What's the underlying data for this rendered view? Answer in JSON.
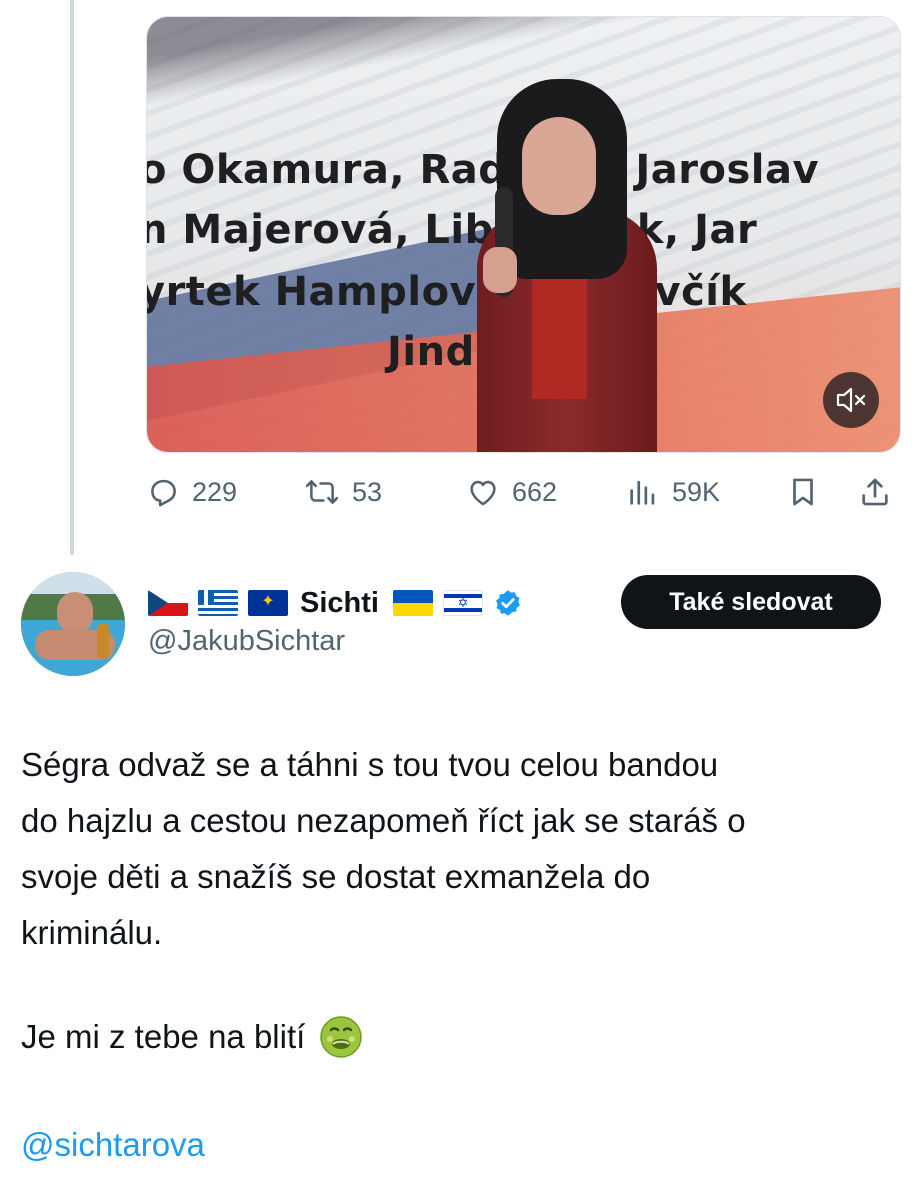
{
  "video": {
    "banner_lines": [
      "o Okamura, Rad   iala, Jaroslav",
      "n Majerová, Lib   dráček, Jar",
      "yrtek Hamplov   slav Ševčík",
      "Jind   ichl"
    ],
    "mute_icon": "speaker-muted-icon"
  },
  "actions": {
    "replies": "229",
    "reposts": "53",
    "likes": "662",
    "views": "59K",
    "icons": [
      "reply-icon",
      "repost-icon",
      "like-icon",
      "views-icon",
      "bookmark-icon",
      "share-icon"
    ]
  },
  "reply_tweet": {
    "display_name": "Sichti",
    "handle": "@JakubSichtar",
    "name_flags": [
      "flag-czech",
      "flag-greece",
      "flag-eu",
      "flag-ukraine",
      "flag-israel"
    ],
    "verified_icon": "verified-badge-icon",
    "follow_label": "Také sledovat",
    "text_lines": [
      "Ségra odvaž se a táhni s tou tvou celou bandou",
      "do hajzlu a cestou nezapomeň říct jak se staráš o",
      "svoje děti a snažíš se dostat exmanžela do",
      "kriminálu."
    ],
    "second_paragraph": "Je mi z tebe na blití",
    "emoji": "nauseated-face-icon",
    "mention": "@sichtarova"
  },
  "colors": {
    "text": "#0f1419",
    "secondary": "#536471",
    "link": "#1d9bf0",
    "verified": "#1d9bf0",
    "button_bg": "#0f1419"
  }
}
